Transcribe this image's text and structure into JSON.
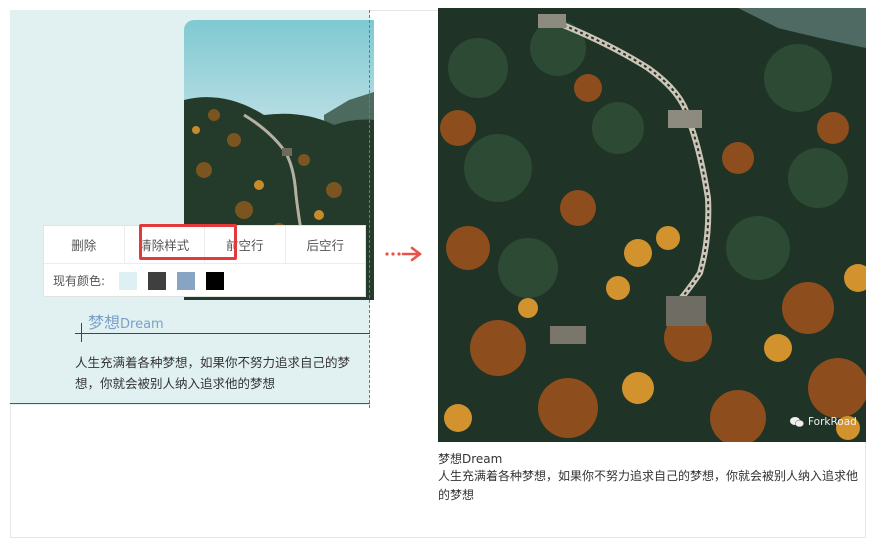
{
  "editor": {
    "toolbar": {
      "buttons": [
        "删除",
        "清除样式",
        "前空行",
        "后空行"
      ],
      "colors_label": "现有颜色:",
      "swatches": [
        "#dff0f2",
        "#3f3f3f",
        "#87a4c4",
        "#000000"
      ]
    },
    "title_cn": "梦想",
    "title_en": "Dream",
    "body_line1": "人生充满着各种梦想，如果你不努力追求自己的梦",
    "body_line2": "想，你就会被别人纳入追求他的梦想"
  },
  "preview": {
    "watermark": "ForkRoad",
    "title": "梦想Dream",
    "body": "人生充满着各种梦想，如果你不努力追求自己的梦想，你就会被别人纳入追求他的梦想"
  },
  "colors": {
    "editor_bg": "#e1f1f2",
    "highlight": "#e23a3a",
    "arrow": "#e8524a",
    "title_blue": "#7aa0c9"
  }
}
